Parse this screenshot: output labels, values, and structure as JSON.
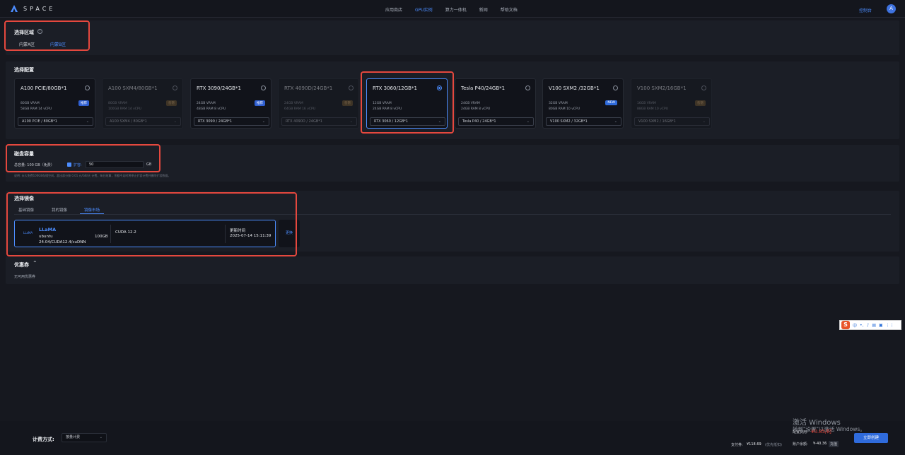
{
  "nav": {
    "brand": "SPACE",
    "links": [
      "应用商店",
      "GPU实例",
      "算力一体机",
      "新闻",
      "帮助文档"
    ],
    "active_index": 1,
    "console": "控制台",
    "avatar": "A"
  },
  "region": {
    "title": "选择区域",
    "info": "i",
    "options": [
      "内蒙A区",
      "内蒙B区"
    ],
    "selected": "内蒙B区"
  },
  "config": {
    "title": "选择配置",
    "cards": [
      {
        "title": "A100 PCIE/80GB*1",
        "vram": "80GB VRAM",
        "spec": "58GB RAM 14 vCPU",
        "badge": "推荐",
        "select": "A100 PCIE / 80GB*1"
      },
      {
        "title": "A100 SXM4/80GB*1",
        "vram": "80GB VRAM",
        "spec": "100GB RAM 14 vCPU",
        "badge": "售罄",
        "select": "A100 SXM4 / 80GB*1"
      },
      {
        "title": "RTX 3090/24GB*1",
        "vram": "24GB VRAM",
        "spec": "48GB RAM 8 vCPU",
        "badge": "推荐",
        "select": "RTX 3090 / 24GB*1"
      },
      {
        "title": "RTX 4090D/24GB*1",
        "vram": "24GB VRAM",
        "spec": "64GB RAM 16 vCPU",
        "badge": "售罄",
        "select": "RTX 4090D / 24GB*1"
      },
      {
        "title": "RTX 3060/12GB*1",
        "vram": "12GB VRAM",
        "spec": "24GB RAM 8 vCPU",
        "badge": "",
        "select": "RTX 3060 / 12GB*1"
      },
      {
        "title": "Tesla P40/24GB*1",
        "vram": "24GB VRAM",
        "spec": "24GB RAM 8 vCPU",
        "badge": "",
        "select": "Tesla P40 / 24GB*1"
      },
      {
        "title": "V100 SXM2 /32GB*1",
        "vram": "32GB VRAM",
        "spec": "80GB RAM 10 vCPU",
        "badge": "NEW",
        "select": "V100 SXM2 / 32GB*1"
      },
      {
        "title": "V100 SXM2/16GB*1",
        "vram": "16GB VRAM",
        "spec": "88GB RAM 10 vCPU",
        "badge": "售罄",
        "select": "V100 SXM2 / 16GB*1"
      }
    ]
  },
  "disk": {
    "title": "磁盘容量",
    "total": "总容量: 100 GB（免费）",
    "expand_label": "扩容:",
    "expand_value": "50",
    "unit": "GB",
    "note": "说明: 永久免费100GB存储空间，超出部分按 0.01 元/GB/天 计费，每日结算，余额不足时将停止扩容计费并删除扩容数据。"
  },
  "images": {
    "title": "选择镜像",
    "tabs": [
      "基础镜像",
      "我的镜像",
      "镜像市场"
    ],
    "active_tab": "镜像市场",
    "card": {
      "logo": "LLaMA",
      "name": "LLaMA",
      "os": "ubuntu",
      "version": "24.04/CUDA12.4/cuDNN",
      "size": "100GB",
      "cuda": "CUDA 12.2",
      "updated_label": "更新时间",
      "updated": "2025-07-14 15:11:39"
    },
    "swap": "更换"
  },
  "coupon": {
    "title": "优惠券",
    "empty": "无可用优惠券"
  },
  "footer": {
    "billing_label": "计费方式:",
    "billing_value": "按量计费",
    "config_fee_label": "配置费用:",
    "config_fee_value": "¥0.85/时",
    "pay_label": "支付券:",
    "pay_value": "¥118.69",
    "pay_note": "(优先抵扣)",
    "balance_label": "账户余额:",
    "balance_value": "¥-40.36",
    "recharge": "充值",
    "create": "立即创建"
  },
  "watermark": {
    "line1": "激活 Windows",
    "line2": "转到\"设置\"以激活 Windows。"
  },
  "colors": {
    "accent": "#4c8dff",
    "highlight": "#e5483e",
    "background": "#16181f"
  }
}
